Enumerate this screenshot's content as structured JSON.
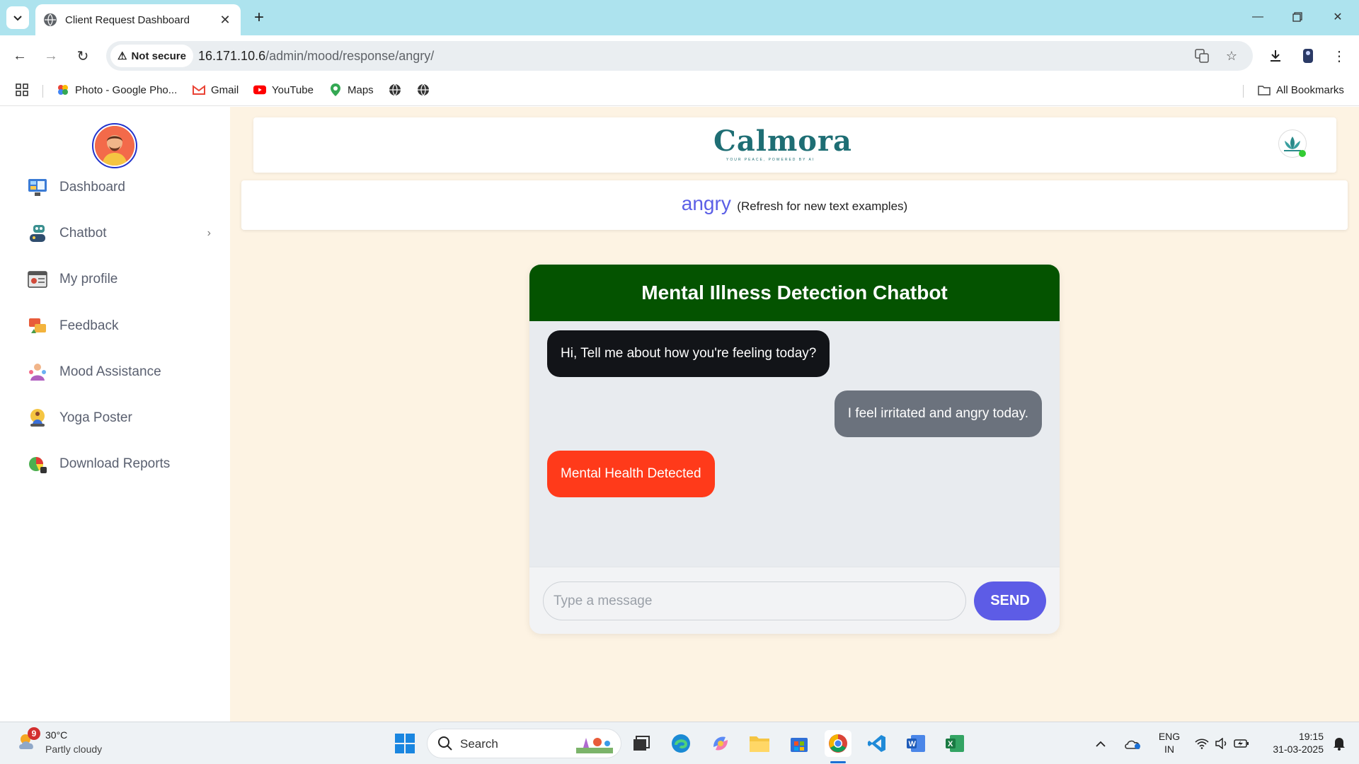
{
  "browser": {
    "tab_title": "Client Request Dashboard",
    "security_label": "Not secure",
    "url_host": "16.171.10.6",
    "url_path": "/admin/mood/response/angry/",
    "bookmarks": [
      {
        "label": "Photo - Google Pho...",
        "icon": "google-photos-icon"
      },
      {
        "label": "Gmail",
        "icon": "gmail-icon"
      },
      {
        "label": "YouTube",
        "icon": "youtube-icon"
      },
      {
        "label": "Maps",
        "icon": "maps-icon"
      }
    ],
    "all_bookmarks_label": "All Bookmarks"
  },
  "sidebar": {
    "items": [
      {
        "label": "Dashboard",
        "icon": "dashboard-icon"
      },
      {
        "label": "Chatbot",
        "icon": "chatbot-icon"
      },
      {
        "label": "My profile",
        "icon": "profile-icon"
      },
      {
        "label": "Feedback",
        "icon": "feedback-icon"
      },
      {
        "label": "Mood Assistance",
        "icon": "mood-icon"
      },
      {
        "label": "Yoga Poster",
        "icon": "yoga-icon"
      },
      {
        "label": "Download Reports",
        "icon": "reports-icon"
      }
    ]
  },
  "header": {
    "brand": "Calmora",
    "tagline": "YOUR PEACE, POWERED BY AI"
  },
  "mood": {
    "word": "angry",
    "note": "(Refresh for new text examples)"
  },
  "chat": {
    "title": "Mental Illness Detection Chatbot",
    "messages": [
      {
        "from": "bot",
        "text": "Hi, Tell me about how you're feeling today?"
      },
      {
        "from": "user",
        "text": "I feel irritated and angry today."
      },
      {
        "from": "result",
        "text": "Mental Health Detected"
      }
    ],
    "input_placeholder": "Type a message",
    "send_label": "SEND"
  },
  "taskbar": {
    "weather_badge": "9",
    "temperature": "30°C",
    "weather": "Partly cloudy",
    "search_label": "Search",
    "lang_line1": "ENG",
    "lang_line2": "IN",
    "time": "19:15",
    "date": "31-03-2025"
  },
  "colors": {
    "chat_header": "#045300",
    "alert": "#ff3a1a",
    "send": "#5d5ce6",
    "page_bg": "#fdf3e3",
    "brand": "#1e6e74"
  }
}
